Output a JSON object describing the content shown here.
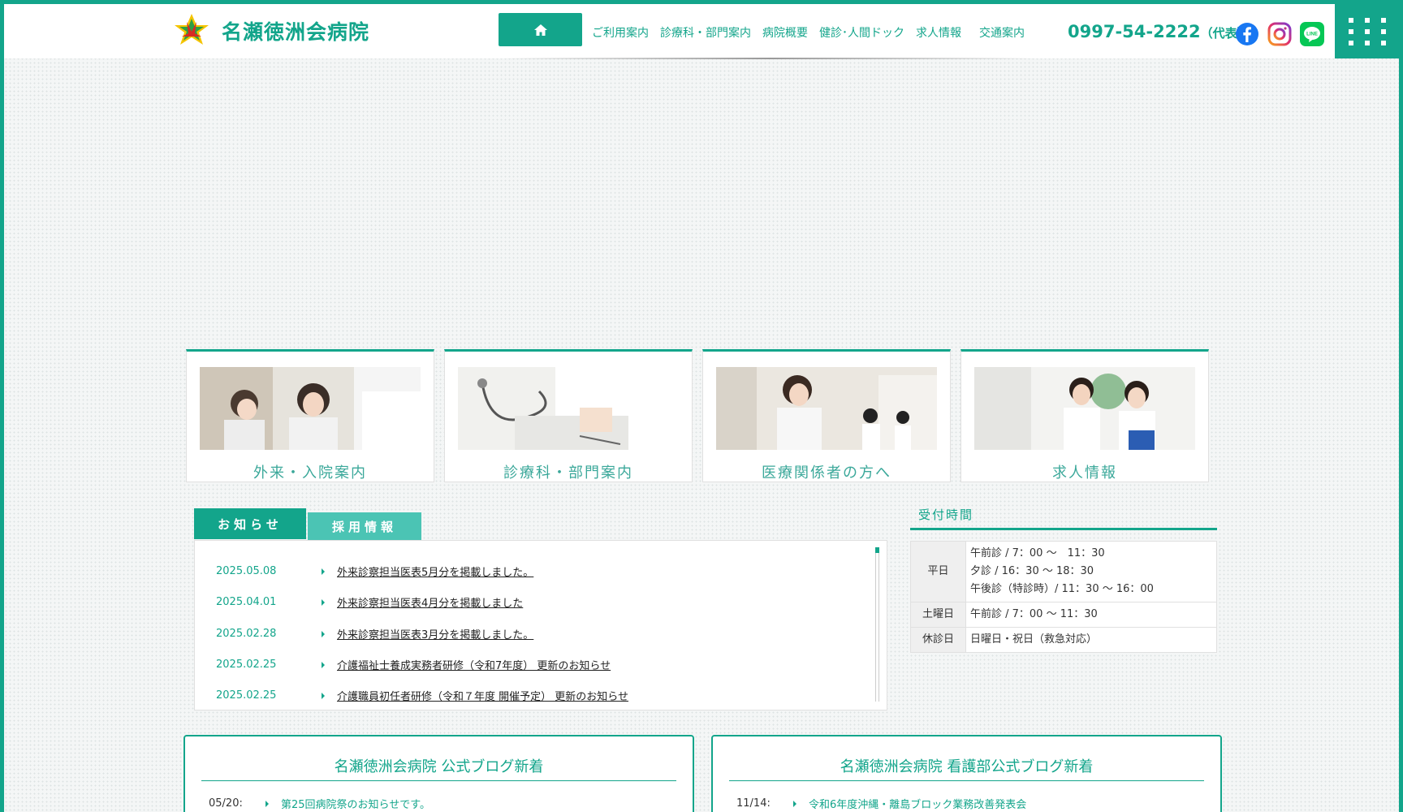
{
  "header": {
    "site_name": "名瀬徳洲会病院",
    "nav": [
      "ご利用案内",
      "診療科・部門案内",
      "病院概要",
      "健診･人間ドック",
      "求人情報",
      "交通案内"
    ],
    "phone": "0997-54-2222",
    "phone_suffix": "（代表）",
    "colors": {
      "brand": "#13a58b",
      "facebook": "#1877f2",
      "line": "#06c755"
    }
  },
  "cards": [
    {
      "label": "外来・入院案内"
    },
    {
      "label": "診療科・部門案内"
    },
    {
      "label": "医療関係者の方へ"
    },
    {
      "label": "求人情報"
    }
  ],
  "news": {
    "tabs": [
      "お知らせ",
      "採用情報"
    ],
    "items": [
      {
        "date": "2025.05.08",
        "title": "外来診察担当医表5月分を掲載しました。"
      },
      {
        "date": "2025.04.01",
        "title": "外来診察担当医表4月分を掲載しました"
      },
      {
        "date": "2025.02.28",
        "title": "外来診察担当医表3月分を掲載しました。"
      },
      {
        "date": "2025.02.25",
        "title": "介護福祉士養成実務者研修（令和7年度） 更新のお知らせ"
      },
      {
        "date": "2025.02.25",
        "title": "介護職員初任者研修（令和７年度 開催予定） 更新のお知らせ"
      }
    ]
  },
  "hours": {
    "title": "受付時間",
    "rows": [
      {
        "label": "平日",
        "lines": [
          "午前診 / 7：00 ～　11：30",
          "夕診 / 16：30 ～ 18：30",
          "午後診（特診時）/ 11：30 ～ 16：00"
        ]
      },
      {
        "label": "土曜日",
        "lines": [
          "午前診 / 7：00 ～ 11：30"
        ]
      },
      {
        "label": "休診日",
        "lines": [
          "日曜日・祝日（救急対応）"
        ]
      }
    ]
  },
  "blogs": [
    {
      "title": "名瀬徳洲会病院 公式ブログ新着",
      "date": "05/20:",
      "text": "第25回病院祭のお知らせです。"
    },
    {
      "title": "名瀬徳洲会病院 看護部公式ブログ新着",
      "date": "11/14:",
      "text": "令和6年度沖縄・離島ブロック業務改善発表会"
    }
  ]
}
